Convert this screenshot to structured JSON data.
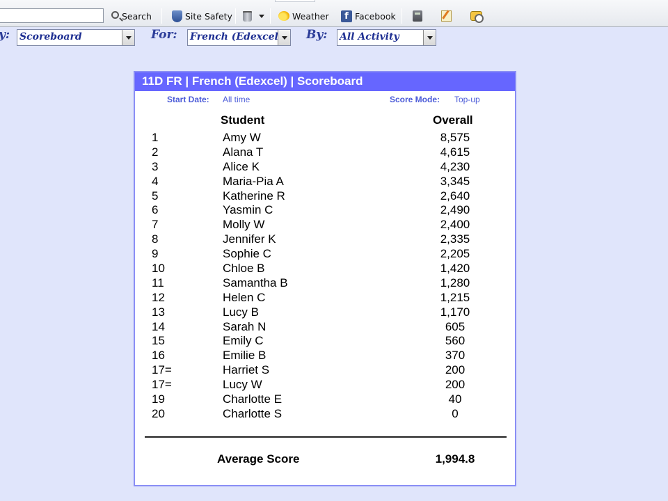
{
  "toolbar": {
    "search_label": "Search",
    "site_safety_label": "Site Safety",
    "weather_label": "Weather",
    "facebook_label": "Facebook"
  },
  "filters": {
    "view_label": "y:",
    "view_value": "Scoreboard",
    "for_label": "For:",
    "for_value": "French (Edexcel)",
    "by_label": "By:",
    "by_value": "All Activity"
  },
  "scoreboard": {
    "title": "11D FR | French (Edexcel) | Scoreboard",
    "start_date_label": "Start Date:",
    "start_date_value": "All time",
    "score_mode_label": "Score Mode:",
    "score_mode_value": "Top-up",
    "col_student": "Student",
    "col_overall": "Overall",
    "rows": [
      {
        "rank": "1",
        "name": "Amy W",
        "score": "8,575"
      },
      {
        "rank": "2",
        "name": "Alana T",
        "score": "4,615"
      },
      {
        "rank": "3",
        "name": "Alice K",
        "score": "4,230"
      },
      {
        "rank": "4",
        "name": "Maria-Pia A",
        "score": "3,345"
      },
      {
        "rank": "5",
        "name": "Katherine R",
        "score": "2,640"
      },
      {
        "rank": "6",
        "name": "Yasmin C",
        "score": "2,490"
      },
      {
        "rank": "7",
        "name": "Molly W",
        "score": "2,400"
      },
      {
        "rank": "8",
        "name": "Jennifer K",
        "score": "2,335"
      },
      {
        "rank": "9",
        "name": "Sophie C",
        "score": "2,205"
      },
      {
        "rank": "10",
        "name": "Chloe B",
        "score": "1,420"
      },
      {
        "rank": "11",
        "name": "Samantha B",
        "score": "1,280"
      },
      {
        "rank": "12",
        "name": "Helen C",
        "score": "1,215"
      },
      {
        "rank": "13",
        "name": "Lucy B",
        "score": "1,170"
      },
      {
        "rank": "14",
        "name": "Sarah N",
        "score": "605"
      },
      {
        "rank": "15",
        "name": "Emily C",
        "score": "560"
      },
      {
        "rank": "16",
        "name": "Emilie B",
        "score": "370"
      },
      {
        "rank": "17=",
        "name": "Harriet S",
        "score": "200"
      },
      {
        "rank": "17=",
        "name": "Lucy W",
        "score": "200"
      },
      {
        "rank": "19",
        "name": "Charlotte E",
        "score": "40"
      },
      {
        "rank": "20",
        "name": "Charlotte S",
        "score": "0"
      }
    ],
    "average_label": "Average Score",
    "average_value": "1,994.8"
  },
  "colors": {
    "header_bg": "#6666ff",
    "page_bg": "#e0e5fb",
    "filter_text": "#2c3d99"
  }
}
